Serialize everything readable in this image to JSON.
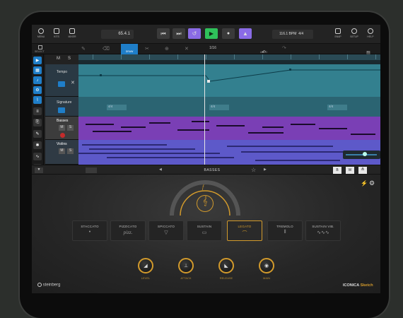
{
  "toolbar": {
    "menu_label": "MENU",
    "kits_label": "KITS",
    "mixer_label": "MIXER",
    "position": "65.4.1",
    "tempo": "116.1 BPM",
    "signature": "4/4",
    "snap_label": "SNAP",
    "setup_label": "SETUP",
    "help_label": "HELP",
    "transport": {
      "rewind": "⏮",
      "forward": "⏭",
      "cycle": "↺",
      "play": "▶",
      "record": "●",
      "metronome": "▲"
    }
  },
  "edit_bar": {
    "select_label": "SELECT",
    "draw_label": "DRAW",
    "quantize": "1/16",
    "undo_label": "UNDO",
    "fx_label": "FX"
  },
  "tracks": [
    {
      "name": "Tempo",
      "type": "tempo"
    },
    {
      "name": "Signature",
      "type": "signature",
      "markers": [
        "4/4",
        "4/4",
        "4/4"
      ]
    },
    {
      "name": "Basses",
      "type": "instrument",
      "mute": "M",
      "solo": "S"
    },
    {
      "name": "Violins",
      "type": "instrument",
      "mute": "M",
      "solo": "S"
    }
  ],
  "global_mute": "M",
  "global_solo": "S",
  "instrument_bar": {
    "preset_name": "BASSES",
    "prev": "◀",
    "next": "▶",
    "star": "☆",
    "btn_b": "B",
    "btn_w": "W"
  },
  "articulation": {
    "dynamic_mark": "f",
    "patterns": [
      {
        "name": "STACCATO",
        "symbol": "•"
      },
      {
        "name": "PIZZICATO",
        "symbol": "pizz."
      },
      {
        "name": "SPICCATO",
        "symbol": "▽"
      },
      {
        "name": "SUSTAIN",
        "symbol": "▭"
      },
      {
        "name": "LEGATO",
        "symbol": "⌒",
        "active": true
      },
      {
        "name": "TREMOLO",
        "symbol": "⦀"
      },
      {
        "name": "SUSTAIN VIB.",
        "symbol": "∿∿∿"
      }
    ]
  },
  "knobs": [
    {
      "label": "LEVEL",
      "icon": "level-icon"
    },
    {
      "label": "ATTACK",
      "icon": "attack-icon"
    },
    {
      "label": "RELEASE",
      "icon": "release-icon"
    },
    {
      "label": "MAIN",
      "icon": "main-icon"
    }
  ],
  "footer": {
    "brand": "steinberg",
    "product": "ICONICA",
    "product_suffix": "Sketch"
  },
  "colors": {
    "accent_blue": "#1f7ec8",
    "play_green": "#2fc15a",
    "cycle_purple": "#8a6be6",
    "bass_purple": "#7a3fb5",
    "gold": "#d29a2c"
  }
}
